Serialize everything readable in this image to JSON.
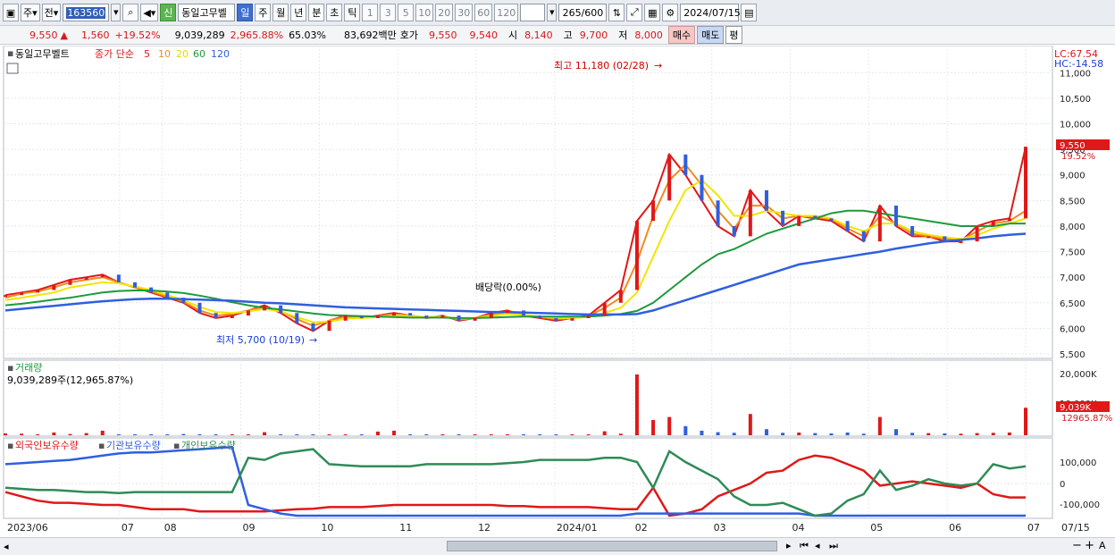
{
  "toolbar": {
    "type_label": "주",
    "prev_label": "전",
    "code": "163560",
    "stock_name": "동일고무벨",
    "badge_new": "신",
    "periods": [
      "일",
      "주",
      "월",
      "년",
      "분",
      "초",
      "틱"
    ],
    "minute_options": [
      "1",
      "3",
      "5",
      "10",
      "20",
      "30",
      "60",
      "120"
    ],
    "count": "265",
    "count_total": "/600",
    "date": "2024/07/15"
  },
  "quote": {
    "price": "9,550",
    "change": "1,560",
    "change_pct": "+19.52%",
    "volume": "9,039,289",
    "vol_ratio": "2,965.88%",
    "turnover": "65.03%",
    "amount": "83,692백만",
    "bid_label": "호가",
    "ask_price": "9,550",
    "bid_price": "9,540",
    "open_label": "시",
    "open": "8,140",
    "high_label": "고",
    "high": "9,700",
    "low_label": "저",
    "low": "8,000",
    "buy_label": "매수",
    "sell_label": "매도",
    "avg_label": "평"
  },
  "legend": {
    "name": "동일고무벨트",
    "ma_label": "종가 단순",
    "ma_periods": [
      "5",
      "10",
      "20",
      "60",
      "120"
    ],
    "ma_colors": [
      "#e01818",
      "#f08c1e",
      "#f0e600",
      "#1e9a3c",
      "#2f5fe0"
    ]
  },
  "axis_info": {
    "lc": "LC:67.54",
    "hc": "HC:-14.58",
    "last_price": "9,550",
    "last_pct": "19.52%"
  },
  "annotations": {
    "high": "최고 11,180 (02/28)",
    "low": "최저 5,700 (10/19)",
    "dividend": "배당락(0.00%)"
  },
  "volume_panel": {
    "title": "거래량",
    "value": "9,039,289주(12,965.87%)",
    "last": "9,039K",
    "last_pct": "12965.87%",
    "ticks": [
      "20,000K",
      "10,000K"
    ]
  },
  "holdings_panel": {
    "series": [
      "외국인보유수량",
      "기관보유수량",
      "개인보유수량"
    ],
    "colors": [
      "#e01818",
      "#2f5fe0",
      "#2e8b57"
    ],
    "ticks": [
      "100,000",
      "0",
      "-100,000"
    ]
  },
  "x_axis": {
    "labels": [
      "2023/06",
      "07",
      "08",
      "09",
      "10",
      "11",
      "12",
      "2024/01",
      "02",
      "03",
      "04",
      "05",
      "06",
      "07",
      "07/15"
    ]
  },
  "chart_data": {
    "type": "line",
    "title": "동일고무벨트",
    "ylim": [
      5500,
      11180
    ],
    "yticks": [
      5500,
      6000,
      6500,
      7000,
      7500,
      8000,
      8500,
      9000,
      9500,
      10000,
      10500,
      11000
    ],
    "x_months": [
      "2023/06",
      "07",
      "08",
      "09",
      "10",
      "11",
      "12",
      "2024/01",
      "02",
      "03",
      "04",
      "05",
      "06",
      "07"
    ],
    "series": [
      {
        "name": "5",
        "values": [
          6650,
          6700,
          6750,
          6850,
          6950,
          7000,
          7050,
          6900,
          6800,
          6700,
          6600,
          6500,
          6300,
          6200,
          6250,
          6350,
          6450,
          6300,
          6100,
          5950,
          6150,
          6250,
          6200,
          6250,
          6300,
          6250,
          6200,
          6250,
          6150,
          6200,
          6300,
          6350,
          6250,
          6200,
          6150,
          6200,
          6250,
          6500,
          6750,
          8100,
          8500,
          9400,
          9000,
          8500,
          8000,
          7800,
          8700,
          8300,
          8000,
          8200,
          8150,
          8100,
          7900,
          7700,
          8400,
          8000,
          7800,
          7800,
          7700,
          7700,
          8000,
          8100,
          8150,
          9550
        ]
      },
      {
        "name": "10",
        "values": [
          6600,
          6680,
          6720,
          6800,
          6900,
          6950,
          7000,
          6900,
          6800,
          6720,
          6620,
          6520,
          6350,
          6250,
          6280,
          6350,
          6420,
          6330,
          6180,
          6050,
          6150,
          6230,
          6210,
          6240,
          6280,
          6250,
          6210,
          6240,
          6170,
          6200,
          6270,
          6320,
          6260,
          6220,
          6180,
          6200,
          6240,
          6400,
          6600,
          7300,
          8200,
          8900,
          9200,
          8800,
          8300,
          7950,
          8400,
          8400,
          8150,
          8200,
          8180,
          8130,
          7950,
          7800,
          8200,
          8050,
          7850,
          7800,
          7750,
          7720,
          7900,
          8050,
          8100,
          8300
        ]
      },
      {
        "name": "20",
        "values": [
          6550,
          6600,
          6650,
          6700,
          6800,
          6850,
          6900,
          6880,
          6820,
          6750,
          6650,
          6550,
          6420,
          6320,
          6300,
          6330,
          6380,
          6330,
          6220,
          6120,
          6130,
          6190,
          6200,
          6220,
          6250,
          6240,
          6220,
          6230,
          6190,
          6200,
          6240,
          6280,
          6260,
          6230,
          6200,
          6200,
          6220,
          6300,
          6400,
          6700,
          7400,
          8100,
          8700,
          8900,
          8600,
          8200,
          8200,
          8300,
          8250,
          8200,
          8200,
          8150,
          8000,
          7900,
          8050,
          8050,
          7900,
          7830,
          7780,
          7750,
          7820,
          7950,
          8050,
          8150
        ]
      },
      {
        "name": "60",
        "values": [
          6450,
          6480,
          6520,
          6560,
          6600,
          6650,
          6700,
          6730,
          6740,
          6740,
          6720,
          6690,
          6640,
          6580,
          6510,
          6450,
          6400,
          6370,
          6330,
          6290,
          6260,
          6250,
          6240,
          6230,
          6220,
          6210,
          6210,
          6210,
          6200,
          6200,
          6210,
          6220,
          6230,
          6230,
          6230,
          6230,
          6230,
          6250,
          6280,
          6340,
          6500,
          6750,
          7000,
          7250,
          7450,
          7550,
          7700,
          7850,
          7950,
          8050,
          8150,
          8250,
          8300,
          8300,
          8250,
          8200,
          8150,
          8100,
          8050,
          8000,
          8000,
          8000,
          8050,
          8050
        ]
      },
      {
        "name": "120",
        "values": [
          6350,
          6380,
          6410,
          6440,
          6470,
          6500,
          6530,
          6550,
          6570,
          6580,
          6580,
          6570,
          6560,
          6550,
          6540,
          6520,
          6500,
          6490,
          6470,
          6450,
          6430,
          6410,
          6400,
          6390,
          6380,
          6370,
          6360,
          6350,
          6340,
          6330,
          6320,
          6320,
          6310,
          6300,
          6290,
          6280,
          6270,
          6270,
          6270,
          6280,
          6350,
          6450,
          6550,
          6650,
          6750,
          6850,
          6950,
          7050,
          7150,
          7250,
          7300,
          7350,
          7400,
          7450,
          7500,
          7560,
          7610,
          7660,
          7700,
          7730,
          7760,
          7800,
          7830,
          7850
        ]
      }
    ],
    "volume_k": [
      600,
      500,
      300,
      900,
      400,
      700,
      1500,
      300,
      300,
      200,
      300,
      400,
      200,
      300,
      300,
      250,
      1000,
      200,
      150,
      300,
      200,
      200,
      150,
      1200,
      1500,
      300,
      200,
      150,
      100,
      200,
      150,
      200,
      100,
      200,
      250,
      200,
      300,
      1300,
      500,
      20000,
      5000,
      6000,
      3000,
      1500,
      1000,
      800,
      7000,
      2000,
      800,
      900,
      700,
      600,
      900,
      500,
      6000,
      2000,
      800,
      700,
      600,
      500,
      700,
      800,
      900,
      9039
    ],
    "holdings": {
      "외국인보유수량": [
        -40000,
        -60000,
        -80000,
        -90000,
        -90000,
        -95000,
        -100000,
        -100000,
        -110000,
        -120000,
        -120000,
        -120000,
        -130000,
        -130000,
        -130000,
        -130000,
        -130000,
        -125000,
        -120000,
        -118000,
        -110000,
        -110000,
        -110000,
        -105000,
        -100000,
        -100000,
        -100000,
        -100000,
        -100000,
        -100000,
        -100000,
        -105000,
        -105000,
        -110000,
        -110000,
        -110000,
        -110000,
        -115000,
        -120000,
        -120000,
        -20000,
        -150000,
        -140000,
        -120000,
        -60000,
        -30000,
        0,
        50000,
        60000,
        110000,
        130000,
        120000,
        90000,
        60000,
        -10000,
        0,
        10000,
        0,
        -10000,
        -20000,
        0,
        -50000,
        -65000,
        -65000
      ],
      "기관보유수량": [
        90000,
        95000,
        100000,
        105000,
        110000,
        120000,
        130000,
        140000,
        145000,
        145000,
        150000,
        155000,
        160000,
        165000,
        170000,
        -100000,
        -120000,
        -140000,
        -150000,
        -150000,
        -150000,
        -150000,
        -150000,
        -150000,
        -150000,
        -150000,
        -150000,
        -150000,
        -150000,
        -150000,
        -150000,
        -150000,
        -150000,
        -150000,
        -150000,
        -150000,
        -150000,
        -150000,
        -150000,
        -140000,
        -140000,
        -140000,
        -140000,
        -140000,
        -140000,
        -140000,
        -140000,
        -140000,
        -140000,
        -140000,
        -150000,
        -150000,
        -150000,
        -150000,
        -150000,
        -150000,
        -150000,
        -150000,
        -150000,
        -150000,
        -150000,
        -150000,
        -150000,
        -150000
      ],
      "개인보유수량": [
        -20000,
        -25000,
        -30000,
        -30000,
        -35000,
        -40000,
        -40000,
        -45000,
        -40000,
        -40000,
        -40000,
        -40000,
        -40000,
        -40000,
        -40000,
        120000,
        110000,
        140000,
        150000,
        160000,
        90000,
        85000,
        80000,
        80000,
        80000,
        80000,
        90000,
        90000,
        90000,
        90000,
        90000,
        95000,
        100000,
        110000,
        110000,
        110000,
        110000,
        120000,
        120000,
        100000,
        -20000,
        150000,
        100000,
        60000,
        20000,
        -60000,
        -100000,
        -100000,
        -90000,
        -120000,
        -150000,
        -140000,
        -80000,
        -50000,
        60000,
        -30000,
        -10000,
        20000,
        0,
        -10000,
        0,
        90000,
        70000,
        80000
      ]
    }
  }
}
